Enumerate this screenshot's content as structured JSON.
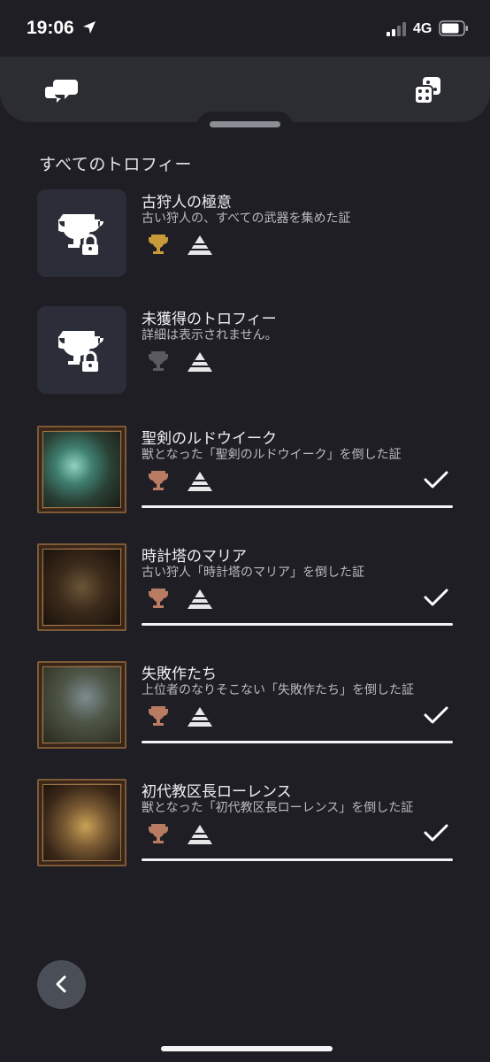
{
  "status_bar": {
    "time": "19:06",
    "network": "4G"
  },
  "section_title": "すべてのトロフィー",
  "trophies": [
    {
      "name": "古狩人の極意",
      "desc": "古い狩人の、すべての武器を集めた証",
      "cup": "gold",
      "locked": true,
      "earned": false
    },
    {
      "name": "未獲得のトロフィー",
      "desc": "詳細は表示されません。",
      "cup": "hidden",
      "locked": true,
      "earned": false
    },
    {
      "name": "聖剣のルドウイーク",
      "desc": "獣となった「聖剣のルドウイーク」を倒した証",
      "cup": "bronze",
      "locked": false,
      "earned": true
    },
    {
      "name": "時計塔のマリア",
      "desc": "古い狩人「時計塔のマリア」を倒した証",
      "cup": "bronze",
      "locked": false,
      "earned": true
    },
    {
      "name": "失敗作たち",
      "desc": "上位者のなりそこない「失敗作たち」を倒した証",
      "cup": "bronze",
      "locked": false,
      "earned": true
    },
    {
      "name": "初代教区長ローレンス",
      "desc": "獣となった「初代教区長ローレンス」を倒した証",
      "cup": "bronze",
      "locked": false,
      "earned": true
    }
  ],
  "colors": {
    "gold": "#c79a3a",
    "bronze": "#b87c62",
    "hidden": "#5a5b60"
  }
}
